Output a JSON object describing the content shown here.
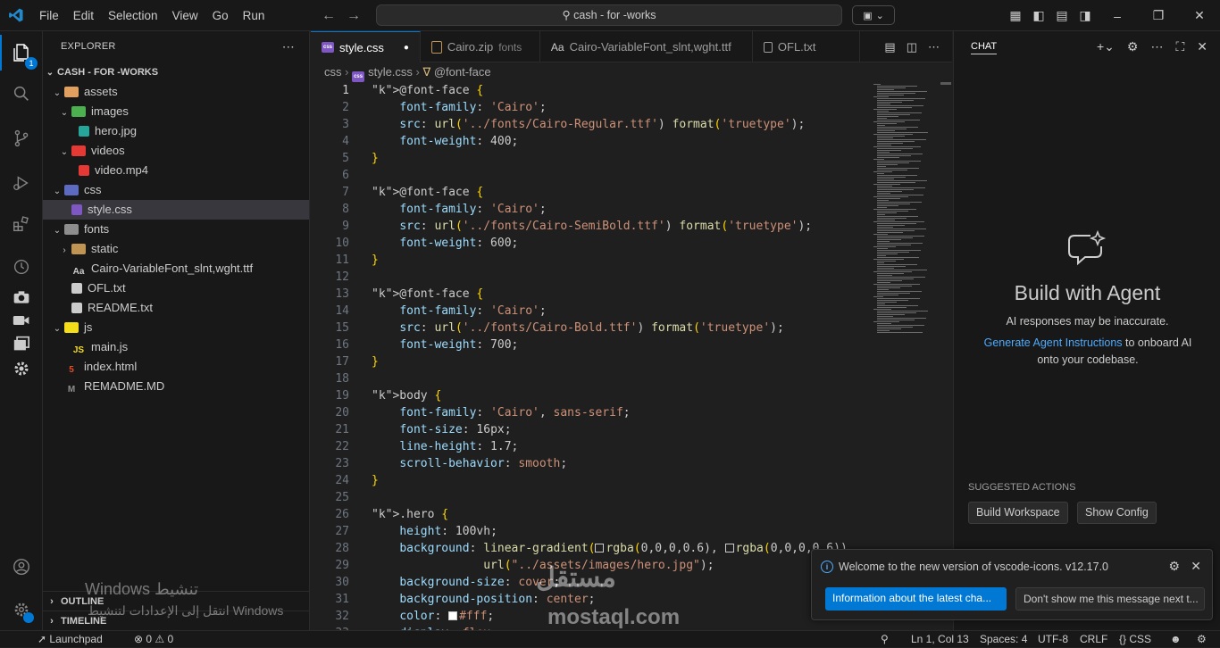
{
  "menu": [
    "File",
    "Edit",
    "Selection",
    "View",
    "Go",
    "Run"
  ],
  "command_center": "cash - for -works",
  "sidebar": {
    "title": "EXPLORER",
    "root": "CASH - FOR -WORKS",
    "tree": [
      {
        "label": "assets",
        "type": "folder",
        "open": true,
        "depth": 1,
        "icon": "folder-assets-icon",
        "color": "#e1a05f"
      },
      {
        "label": "images",
        "type": "folder",
        "open": true,
        "depth": 2,
        "icon": "folder-images-icon",
        "color": "#4caf50"
      },
      {
        "label": "hero.jpg",
        "type": "file",
        "depth": 3,
        "icon": "image-file-icon",
        "color": "#26a69a"
      },
      {
        "label": "videos",
        "type": "folder",
        "open": true,
        "depth": 2,
        "icon": "folder-videos-icon",
        "color": "#e53935"
      },
      {
        "label": "video.mp4",
        "type": "file",
        "depth": 3,
        "icon": "video-file-icon",
        "color": "#e53935"
      },
      {
        "label": "css",
        "type": "folder",
        "open": true,
        "depth": 1,
        "icon": "folder-css-icon",
        "color": "#5c6bc0"
      },
      {
        "label": "style.css",
        "type": "file",
        "depth": 2,
        "icon": "css-file-icon",
        "color": "#7e57c2",
        "selected": true
      },
      {
        "label": "fonts",
        "type": "folder",
        "open": true,
        "depth": 1,
        "icon": "folder-fonts-icon",
        "color": "#8d8d8d"
      },
      {
        "label": "static",
        "type": "folder",
        "open": false,
        "depth": 2,
        "icon": "folder-icon",
        "color": "#c09553"
      },
      {
        "label": "Cairo-VariableFont_slnt,wght.ttf",
        "type": "file",
        "depth": 2,
        "icon": "font-file-icon",
        "color": "#cccccc",
        "glyph": "Aa"
      },
      {
        "label": "OFL.txt",
        "type": "file",
        "depth": 2,
        "icon": "text-file-icon",
        "color": "#cccccc"
      },
      {
        "label": "README.txt",
        "type": "file",
        "depth": 2,
        "icon": "text-file-icon",
        "color": "#cccccc"
      },
      {
        "label": "js",
        "type": "folder",
        "open": true,
        "depth": 1,
        "icon": "folder-js-icon",
        "color": "#f5de19"
      },
      {
        "label": "main.js",
        "type": "file",
        "depth": 2,
        "icon": "js-file-icon",
        "color": "#f5de19",
        "glyph": "JS"
      },
      {
        "label": "index.html",
        "type": "file",
        "depth": 1,
        "icon": "html-file-icon",
        "color": "#e44d26",
        "glyph": "5"
      },
      {
        "label": "REMADME.MD",
        "type": "file",
        "depth": 1,
        "icon": "markdown-file-icon",
        "color": "#8d8d8d",
        "glyph": "M"
      }
    ],
    "outline": "OUTLINE",
    "timeline": "TIMELINE"
  },
  "tabs": [
    {
      "label": "style.css",
      "active": true,
      "dirty": true
    },
    {
      "label": "Cairo.zip",
      "sub": "fonts"
    },
    {
      "label": "Cairo-VariableFont_slnt,wght.ttf"
    },
    {
      "label": "OFL.txt"
    }
  ],
  "breadcrumb": [
    "css",
    "style.css",
    "@font-face"
  ],
  "code_lines": [
    "@font-face {",
    "    font-family: 'Cairo';",
    "    src: url('../fonts/Cairo-Regular.ttf') format('truetype');",
    "    font-weight: 400;",
    "}",
    "",
    "@font-face {",
    "    font-family: 'Cairo';",
    "    src: url('../fonts/Cairo-SemiBold.ttf') format('truetype');",
    "    font-weight: 600;",
    "}",
    "",
    "@font-face {",
    "    font-family: 'Cairo';",
    "    src: url('../fonts/Cairo-Bold.ttf') format('truetype');",
    "    font-weight: 700;",
    "}",
    "",
    "body {",
    "    font-family: 'Cairo', sans-serif;",
    "    font-size: 16px;",
    "    line-height: 1.7;",
    "    scroll-behavior: smooth;",
    "}",
    "",
    ".hero {",
    "    height: 100vh;",
    "    background: linear-gradient(rgba(0,0,0,0.6), rgba(0,0,0,0.6)),",
    "                url(\"../assets/images/hero.jpg\");",
    "    background-size: cover;",
    "    background-position: center;",
    "    color: #fff;",
    "    display: flex;"
  ],
  "chat": {
    "title": "CHAT",
    "heading": "Build with Agent",
    "subtitle": "AI responses may be inaccurate.",
    "link": "Generate Agent Instructions",
    "desc_rest": " to onboard AI onto your codebase.",
    "suggested": "SUGGESTED ACTIONS",
    "actions": [
      "Build Workspace",
      "Show Config"
    ]
  },
  "notification": {
    "message": "Welcome to the new version of vscode-icons. v12.17.0",
    "primary": "Information about the latest cha...",
    "secondary": "Don't show me this message next t..."
  },
  "status": {
    "launchpad": "Launchpad",
    "errors": "0",
    "warnings": "0",
    "position": "Ln 1, Col 13",
    "spaces": "Spaces: 4",
    "encoding": "UTF-8",
    "eol": "CRLF",
    "language": "CSS"
  },
  "overlay": {
    "windows_line1": "Windows تنشيط",
    "windows_line2": "انتقل إلى الإعدادات لتنشيط Windows",
    "watermark": "مستقل",
    "watermark_url": "mostaql.com"
  }
}
